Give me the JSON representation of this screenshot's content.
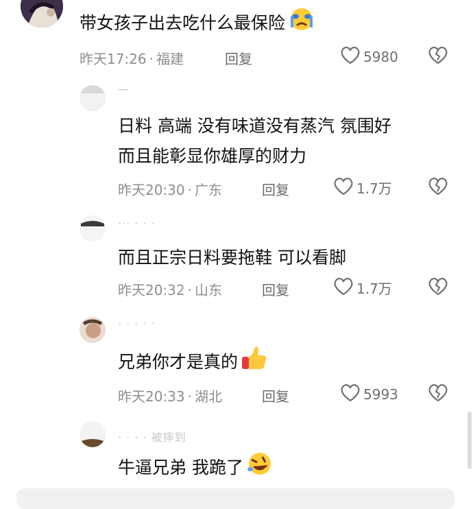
{
  "colors": {
    "text": "#111111",
    "meta": "#8e8e8e",
    "icon": "#6f6f6f",
    "background": "#ffffff"
  },
  "comments": [
    {
      "content_lines": [
        "带女孩子出去吃什么最保险"
      ],
      "emoji": "crying-face-emoji",
      "time": "昨天17:26",
      "location": "福建",
      "reply_label": "回复",
      "likes": "5980"
    },
    {
      "username": "一",
      "content_lines": [
        "日料  高端  没有味道没有蒸汽  氛围好",
        "而且能彰显你雄厚的财力"
      ],
      "time": "昨天20:30",
      "location": "广东",
      "reply_label": "回复",
      "likes": "1.7万"
    },
    {
      "username": "···  ·  · ·",
      "content_lines": [
        "而且正宗日料要拖鞋  可以看脚"
      ],
      "time": "昨天20:32",
      "location": "山东",
      "reply_label": "回复",
      "likes": "1.7万"
    },
    {
      "username": "·  ·  ·  · ·",
      "content_lines": [
        "兄弟你才是真的"
      ],
      "emoji": "thumbs-up-emoji",
      "time": "昨天20:33",
      "location": "湖北",
      "reply_label": "回复",
      "likes": "5993"
    },
    {
      "username": "·  · · ·  被摔到",
      "content_lines": [
        "牛逼兄弟  我跪了"
      ],
      "emoji": "rofl-emoji"
    }
  ],
  "separator": "·"
}
